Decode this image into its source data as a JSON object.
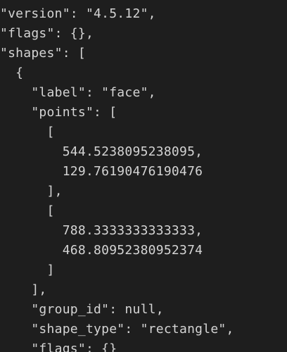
{
  "editor": {
    "background": "#1e1e1e",
    "text_color": "#d4d4d4",
    "lines": [
      "\"version\": \"4.5.12\",",
      "\"flags\": {},",
      "\"shapes\": [",
      "  {",
      "    \"label\": \"face\",",
      "    \"points\": [",
      "      [",
      "        544.5238095238095,",
      "        129.76190476190476",
      "      ],",
      "      [",
      "        788.3333333333333,",
      "        468.80952380952374",
      "      ]",
      "    ],",
      "    \"group_id\": null,",
      "    \"shape_type\": \"rectangle\",",
      "    \"flags\": {}"
    ]
  }
}
